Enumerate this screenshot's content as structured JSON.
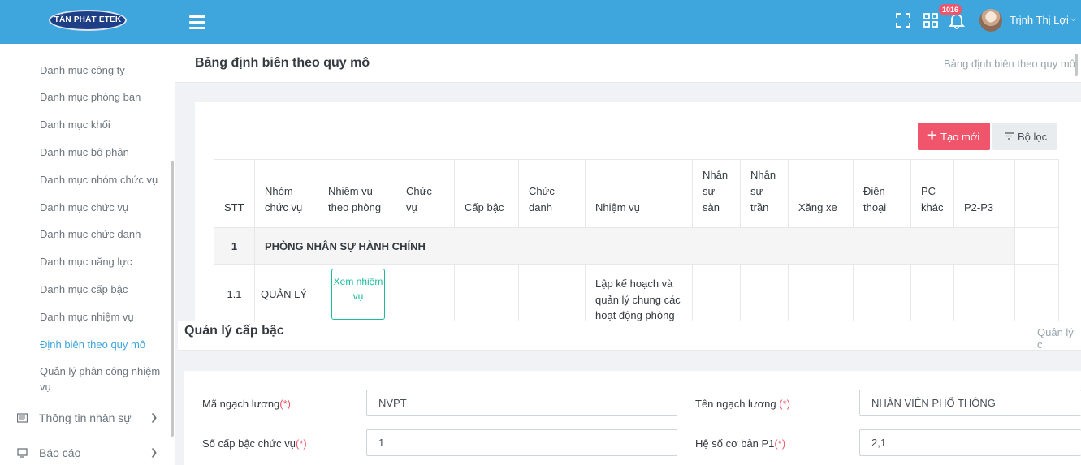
{
  "topbar": {
    "logo_text": "TÂN PHÁT ETEK",
    "notification_count": "1016",
    "user_name": "Trịnh Thị Lợi",
    "colors": {
      "bar": "#3ea5dd",
      "badge": "#f1556c"
    }
  },
  "sidebar": {
    "items": [
      {
        "label": "Danh mục công ty"
      },
      {
        "label": "Danh mục phòng ban"
      },
      {
        "label": "Danh mục khối"
      },
      {
        "label": "Danh mục bộ phận"
      },
      {
        "label": "Danh mục nhóm chức vụ"
      },
      {
        "label": "Danh mục chức vụ"
      },
      {
        "label": "Danh mục chức danh"
      },
      {
        "label": "Danh mục năng lực"
      },
      {
        "label": "Danh mục cấp bậc"
      },
      {
        "label": "Danh mục nhiệm vụ"
      },
      {
        "label": "Định biên theo quy mô",
        "active": true
      },
      {
        "label": "Quản lý phân công nhiệm vụ"
      }
    ],
    "main_items": [
      {
        "label": "Thông tin nhân sự",
        "icon": "id-card-icon"
      },
      {
        "label": "Báo cáo",
        "icon": "monitor-icon"
      }
    ]
  },
  "page1": {
    "title": "Bảng định biên theo quy mô",
    "breadcrumb": "Bảng định biên theo quy mô",
    "create_button": "Tạo mới",
    "filter_button": "Bộ lọc",
    "table": {
      "headers": [
        "STT",
        "Nhóm chức vụ",
        "Nhiệm vụ theo phòng",
        "Chức vụ",
        "Cấp bậc",
        "Chức danh",
        "Nhiệm vụ",
        "Nhân sự sàn",
        "Nhân sự trần",
        "Xăng xe",
        "Điện thoại",
        "PC khác",
        "P2-P3",
        ""
      ],
      "group_row": {
        "stt": "1",
        "name": "PHÒNG NHÂN SỰ HÀNH CHÍNH"
      },
      "row": {
        "stt": "1.1",
        "group": "QUẢN LÝ",
        "view_button": "Xem nhiệm vụ",
        "task": "Lập kế hoạch và quản lý chung các hoạt động phòng"
      }
    }
  },
  "page2": {
    "title": "Quản lý cấp bậc",
    "breadcrumb": "Quản lý c",
    "fields": {
      "ma_ngach_luong": {
        "label": "Mã ngạch lương",
        "required": "(*)",
        "value": "NVPT"
      },
      "ten_ngach_luong": {
        "label": "Tên ngạch lương ",
        "required": "(*)",
        "value": "NHÂN VIÊN PHỔ THÔNG"
      },
      "so_cap_bac": {
        "label": "Số cấp bậc chức vụ",
        "required": "(*)",
        "value": "1"
      },
      "he_so_co_ban": {
        "label": "Hệ số cơ bản P1",
        "required": "(*)",
        "value": "2,1"
      }
    }
  }
}
